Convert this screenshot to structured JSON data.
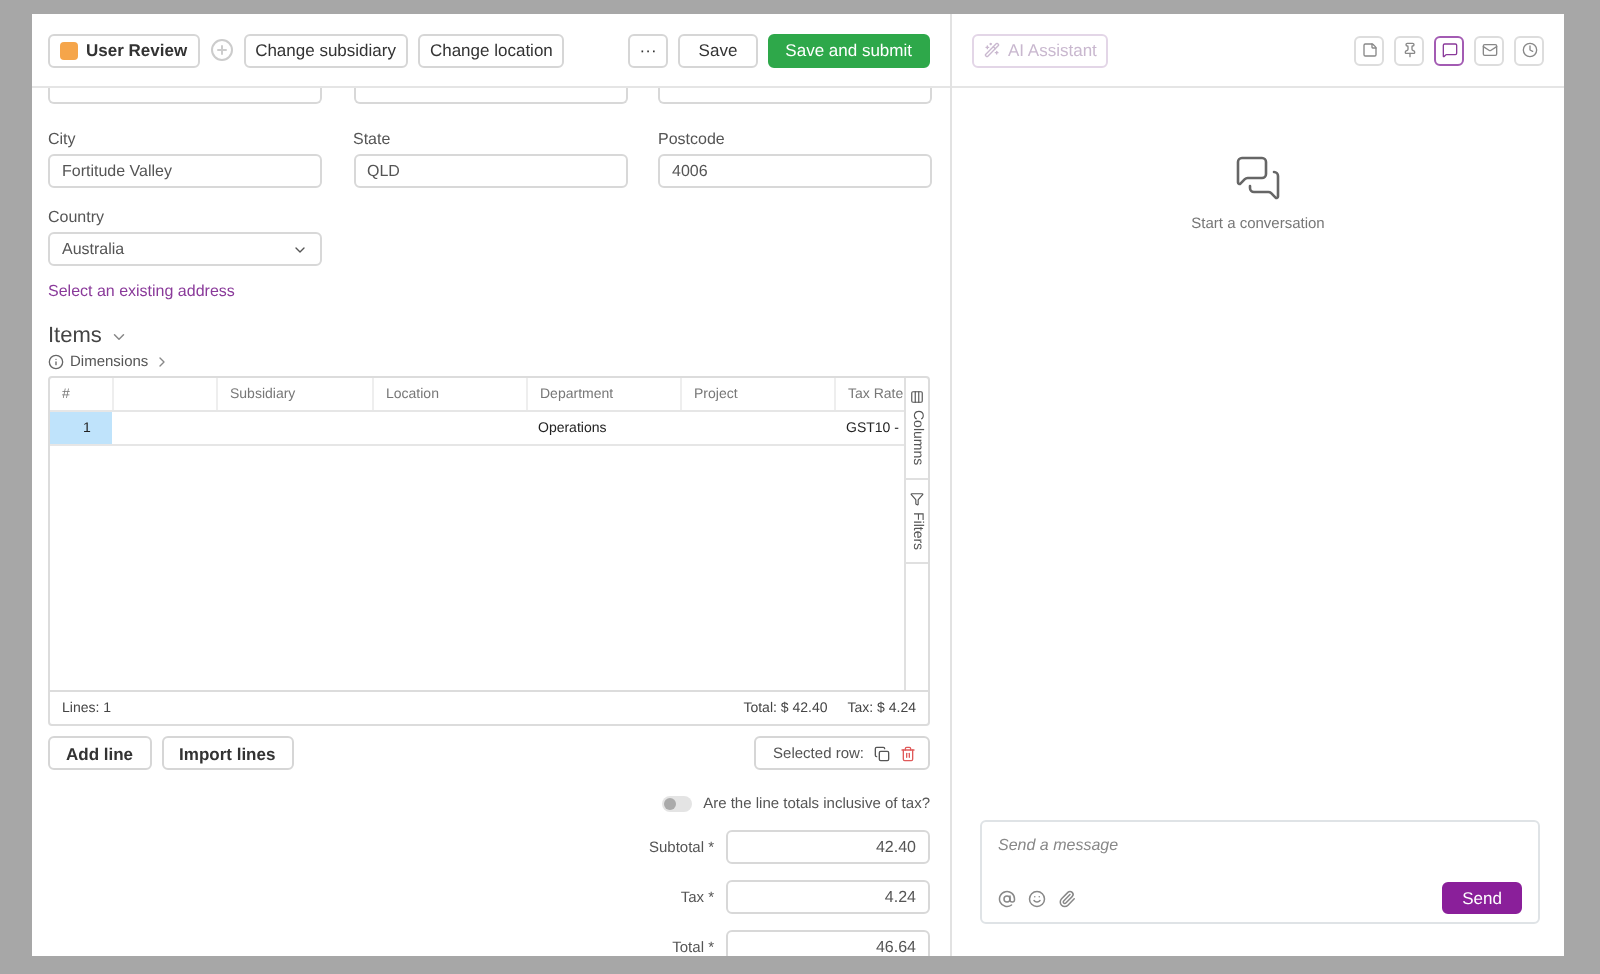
{
  "header": {
    "status": {
      "label": "User Review",
      "color": "#f5a54a"
    },
    "actions": [
      "Change subsidiary",
      "Change location"
    ],
    "more": "···",
    "save": "Save",
    "submit": "Save and submit"
  },
  "address": {
    "fields": [
      {
        "label": "City",
        "value": "Fortitude Valley"
      },
      {
        "label": "State",
        "value": "QLD"
      },
      {
        "label": "Postcode",
        "value": "4006"
      }
    ],
    "country": {
      "label": "Country",
      "value": "Australia"
    },
    "link": "Select an existing address"
  },
  "items": {
    "title": "Items",
    "dimensions": "Dimensions",
    "columns": [
      {
        "label": "#"
      },
      {},
      {
        "label": "Subsidiary"
      },
      {
        "label": "Location"
      },
      {
        "label": "Department"
      },
      {
        "label": "Project"
      },
      {
        "label": "Tax Rate"
      }
    ],
    "rows": [
      {
        "selected": true,
        "cells": [
          "1",
          "",
          "",
          "",
          "Operations",
          "",
          "GST10 -"
        ]
      }
    ],
    "side_tabs": [
      {
        "kind": "columns",
        "label": "Columns"
      },
      {
        "kind": "filters",
        "label": "Filters"
      }
    ],
    "footer": {
      "lines": "Lines: 1",
      "total": "Total: $ 42.40",
      "tax": "Tax: $ 4.24"
    },
    "buttons": [
      "Add line",
      "Import lines"
    ],
    "selected_row": "Selected row:"
  },
  "inclusive": {
    "label": "Are the line totals inclusive of tax?",
    "on": false
  },
  "totals": [
    {
      "label": "Subtotal *",
      "value": "42.40"
    },
    {
      "label": "Tax *",
      "value": "4.24"
    },
    {
      "label": "Total *",
      "value": "46.64"
    }
  ],
  "assistant": {
    "label": "AI Assistant",
    "disabled": true
  },
  "tools": [
    {
      "kind": "note",
      "selected": false
    },
    {
      "kind": "pin",
      "selected": false
    },
    {
      "kind": "chat",
      "selected": true
    },
    {
      "kind": "mail",
      "selected": false
    },
    {
      "kind": "history",
      "selected": false
    }
  ],
  "empty_state": "Start a conversation",
  "composer": {
    "placeholder": "Send a message",
    "send": "Send"
  }
}
